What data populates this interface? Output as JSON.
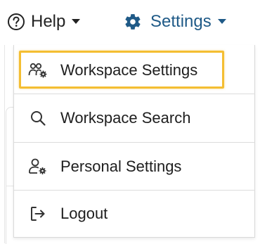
{
  "header": {
    "help_label": "Help",
    "settings_label": "Settings",
    "help_icon": "question-circle-icon",
    "settings_icon": "gear-icon"
  },
  "menu": {
    "items": [
      {
        "label": "Workspace Settings",
        "icon": "users-gear-icon",
        "highlighted": true
      },
      {
        "label": "Workspace Search",
        "icon": "search-icon",
        "highlighted": false
      },
      {
        "label": "Personal Settings",
        "icon": "user-gear-icon",
        "highlighted": false
      },
      {
        "label": "Logout",
        "icon": "logout-icon",
        "highlighted": false
      }
    ]
  },
  "colors": {
    "settings_accent": "#1f5a87",
    "highlight_outline": "#f4be32",
    "text": "#1e1e1e"
  }
}
